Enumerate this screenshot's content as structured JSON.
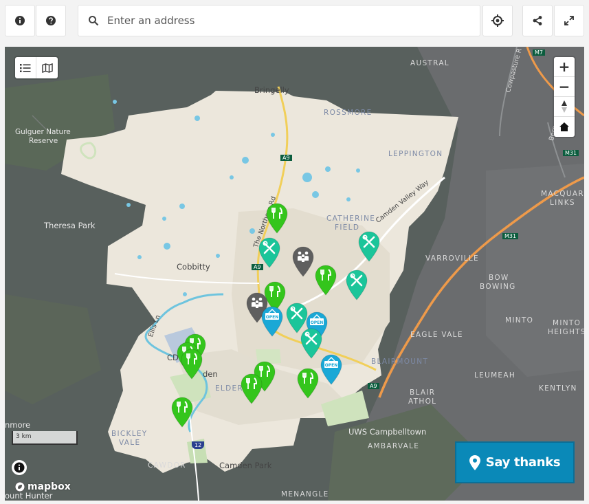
{
  "toolbar": {
    "info_icon": "info-icon",
    "help_icon": "help-icon",
    "search_placeholder": "Enter an address",
    "search_value": "",
    "locate_icon": "crosshair-icon",
    "share_icon": "share-icon",
    "fullscreen_icon": "expand-icon"
  },
  "map": {
    "view_toggle": [
      "list-icon",
      "map-icon"
    ],
    "zoom_in": "+",
    "zoom_out": "−",
    "scale_label": "3 km",
    "attribution": "mapbox",
    "say_thanks": "Say thanks",
    "labels": {
      "austral": "AUSTRAL",
      "bringelly": "Bringelly",
      "rossmore": "ROSSMORE",
      "leppington": "LEPPINGTON",
      "gulguer_1": "Gulguer Nature",
      "gulguer_2": "Reserve",
      "theresa_park": "Theresa Park",
      "catherine_1": "CATHERINE",
      "catherine_2": "FIELD",
      "camden_valley_way": "Camden Valley Way",
      "northern_rd": "The Northern Rd",
      "macquarie_1": "MACQUARIE",
      "macquarie_2": "LINKS",
      "varroville": "VARROVILLE",
      "bow_1": "BOW",
      "bow_2": "BOWING",
      "cobbitty": "Cobbitty",
      "minto": "MINTO",
      "minto_h1": "MINTO",
      "minto_h2": "HEIGHTS",
      "eagle_vale": "EAGLE VALE",
      "ellis_ln": "Ellis Ln",
      "cdu": "CDU",
      "den": "den",
      "blairmount": "BLAIRMOUNT",
      "leumeah": "LEUMEAH",
      "elderslie": "ELDERSLIE",
      "blair_1": "BLAIR",
      "blair_2": "ATHOL",
      "kentlyn": "KENTLYN",
      "nmore": "nmore",
      "bickley_1": "BICKLEY",
      "bickley_2": "VALE",
      "uws": "UWS Campbelltown",
      "ambarvale": "AMBARVALE",
      "cawdor": "CAWDOR",
      "camden_park": "Camden Park",
      "menangle": "MENANGLE",
      "ount_hunter": "ount Hunter",
      "compasture": "Cowpasture R",
      "bernera": "Bernera Rd",
      "a9_1": "A9",
      "a9_2": "A9",
      "a9_3": "A9",
      "m7": "M7",
      "m31_1": "M31",
      "m31_2": "M31",
      "r12": "12"
    },
    "pins": [
      {
        "type": "food",
        "icon": "fork-knife-icon",
        "color": "#34c51c"
      },
      {
        "type": "services",
        "icon": "tools-icon",
        "color": "#1bc59a"
      },
      {
        "type": "community",
        "icon": "people-icon",
        "color": "#5f5f5f"
      },
      {
        "type": "food",
        "icon": "fork-knife-icon",
        "color": "#34c51c"
      },
      {
        "type": "services",
        "icon": "tools-icon",
        "color": "#1bc59a"
      },
      {
        "type": "services",
        "icon": "tools-icon",
        "color": "#1bc59a"
      },
      {
        "type": "food",
        "icon": "fork-knife-icon",
        "color": "#34c51c"
      },
      {
        "type": "community",
        "icon": "people-icon",
        "color": "#5f5f5f"
      },
      {
        "type": "open",
        "icon": "open-sign-icon",
        "color": "#1aa8d6"
      },
      {
        "type": "services",
        "icon": "tools-icon",
        "color": "#1bc59a"
      },
      {
        "type": "open",
        "icon": "open-sign-icon",
        "color": "#1aa8d6"
      },
      {
        "type": "services",
        "icon": "tools-icon",
        "color": "#1bc59a"
      },
      {
        "type": "food",
        "icon": "fork-knife-icon",
        "color": "#34c51c"
      },
      {
        "type": "food",
        "icon": "fork-knife-icon",
        "color": "#34c51c"
      },
      {
        "type": "food",
        "icon": "fork-knife-icon",
        "color": "#34c51c"
      },
      {
        "type": "open",
        "icon": "open-sign-icon",
        "color": "#1aa8d6"
      },
      {
        "type": "food",
        "icon": "fork-knife-icon",
        "color": "#34c51c"
      },
      {
        "type": "food",
        "icon": "fork-knife-icon",
        "color": "#34c51c"
      },
      {
        "type": "food",
        "icon": "fork-knife-icon",
        "color": "#34c51c"
      },
      {
        "type": "food",
        "icon": "fork-knife-icon",
        "color": "#34c51c"
      }
    ],
    "open_text": "OPEN"
  }
}
